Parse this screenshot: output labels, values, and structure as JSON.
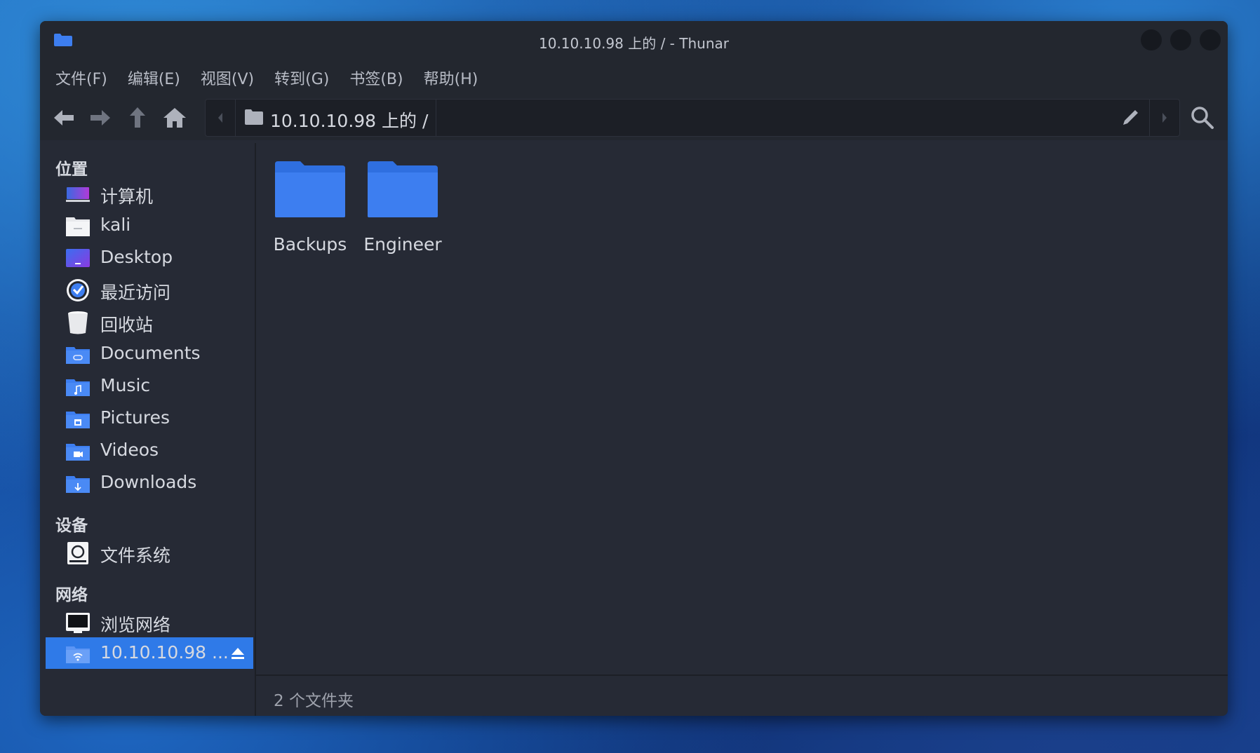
{
  "window": {
    "title": "10.10.10.98 上的 / - Thunar"
  },
  "menu": [
    "文件(F)",
    "编辑(E)",
    "视图(V)",
    "转到(G)",
    "书签(B)",
    "帮助(H)"
  ],
  "pathbar": {
    "crumb": "10.10.10.98 上的 /"
  },
  "sidebar": {
    "places_heading": "位置",
    "devices_heading": "设备",
    "network_heading": "网络",
    "places": [
      {
        "label": "计算机",
        "icon": "computer-icon"
      },
      {
        "label": "kali",
        "icon": "home-folder-icon"
      },
      {
        "label": "Desktop",
        "icon": "desktop-icon"
      },
      {
        "label": "最近访问",
        "icon": "recent-icon"
      },
      {
        "label": "回收站",
        "icon": "trash-icon"
      },
      {
        "label": "Documents",
        "icon": "documents-folder-icon"
      },
      {
        "label": "Music",
        "icon": "music-folder-icon"
      },
      {
        "label": "Pictures",
        "icon": "pictures-folder-icon"
      },
      {
        "label": "Videos",
        "icon": "videos-folder-icon"
      },
      {
        "label": "Downloads",
        "icon": "downloads-folder-icon"
      }
    ],
    "devices": [
      {
        "label": "文件系统",
        "icon": "drive-icon"
      }
    ],
    "network": [
      {
        "label": "浏览网络",
        "icon": "network-icon"
      },
      {
        "label": "10.10.10.98 ...",
        "icon": "network-share-icon",
        "selected": true
      }
    ]
  },
  "files": [
    {
      "name": "Backups",
      "icon": "folder-icon"
    },
    {
      "name": "Engineer",
      "icon": "folder-icon"
    }
  ],
  "status": "2 个文件夹",
  "colors": {
    "accent": "#2f7ae8",
    "folder": "#3d7ef0",
    "background": "#262a35"
  }
}
